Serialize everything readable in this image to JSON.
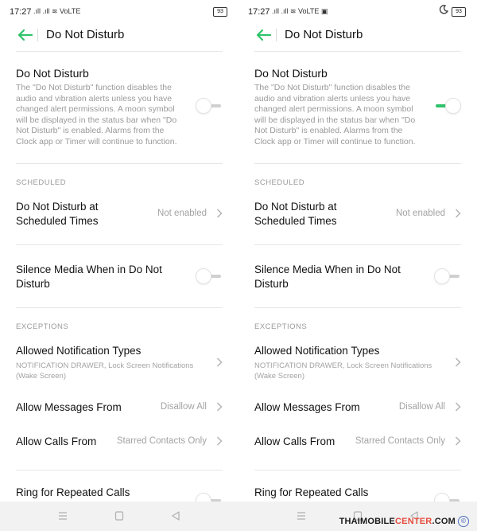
{
  "colors": {
    "accent_green": "#2fc36b",
    "divider": "#e6e6e6",
    "secondary_text": "#9a9a9a"
  },
  "left": {
    "status": {
      "time": "17:27",
      "icons_text": ".ıll .ıll ≋ VoLTE",
      "battery": "93"
    },
    "header": {
      "title": "Do Not Disturb",
      "back_icon": "back-arrow-icon"
    },
    "dnd": {
      "title": "Do Not Disturb",
      "description": "The \"Do Not Disturb\" function disables the audio and vibration alerts unless you have changed alert permissions. A moon symbol will be displayed in the status bar when \"Do Not Disturb\" is enabled. Alarms from the Clock app or Timer will continue to function.",
      "enabled": false
    },
    "scheduled": {
      "header": "SCHEDULED",
      "times_title": "Do Not Disturb at Scheduled Times",
      "times_value": "Not enabled",
      "silence_title": "Silence Media When in Do Not Disturb",
      "silence_enabled": false
    },
    "exceptions": {
      "header": "EXCEPTIONS",
      "notif_title": "Allowed Notification Types",
      "notif_sub": "NOTIFICATION DRAWER, Lock Screen Notifications (Wake Screen)",
      "messages_title": "Allow Messages From",
      "messages_value": "Disallow All",
      "calls_title": "Allow Calls From",
      "calls_value": "Starred Contacts Only",
      "repeat_title": "Ring for Repeated Calls"
    }
  },
  "right": {
    "status": {
      "time": "17:27",
      "icons_text": ".ıll .ıll ≋ VoLTE ▣",
      "battery": "93",
      "moon_icon": "moon-icon"
    },
    "header": {
      "title": "Do Not Disturb",
      "back_icon": "back-arrow-icon"
    },
    "dnd": {
      "title": "Do Not Disturb",
      "description": "The \"Do Not Disturb\" function disables the audio and vibration alerts unless you have changed alert permissions. A moon symbol will be displayed in the status bar when \"Do Not Disturb\" is enabled. Alarms from the Clock app or Timer will continue to function.",
      "enabled": true
    },
    "scheduled": {
      "header": "SCHEDULED",
      "times_title": "Do Not Disturb at Scheduled Times",
      "times_value": "Not enabled",
      "silence_title": "Silence Media When in Do Not Disturb",
      "silence_enabled": false
    },
    "exceptions": {
      "header": "EXCEPTIONS",
      "notif_title": "Allowed Notification Types",
      "notif_sub": "NOTIFICATION DRAWER, Lock Screen Notifications (Wake Screen)",
      "messages_title": "Allow Messages From",
      "messages_value": "Disallow All",
      "calls_title": "Allow Calls From",
      "calls_value": "Starred Contacts Only",
      "repeat_title": "Ring for Repeated Calls"
    }
  },
  "nav": {
    "menu_icon": "menu-icon",
    "home_icon": "home-square-icon",
    "back_icon": "back-triangle-icon"
  },
  "watermark": {
    "part1": "THAIMOBILE",
    "part2": "CENTER",
    "part3": ".COM",
    "copyright": "©"
  }
}
